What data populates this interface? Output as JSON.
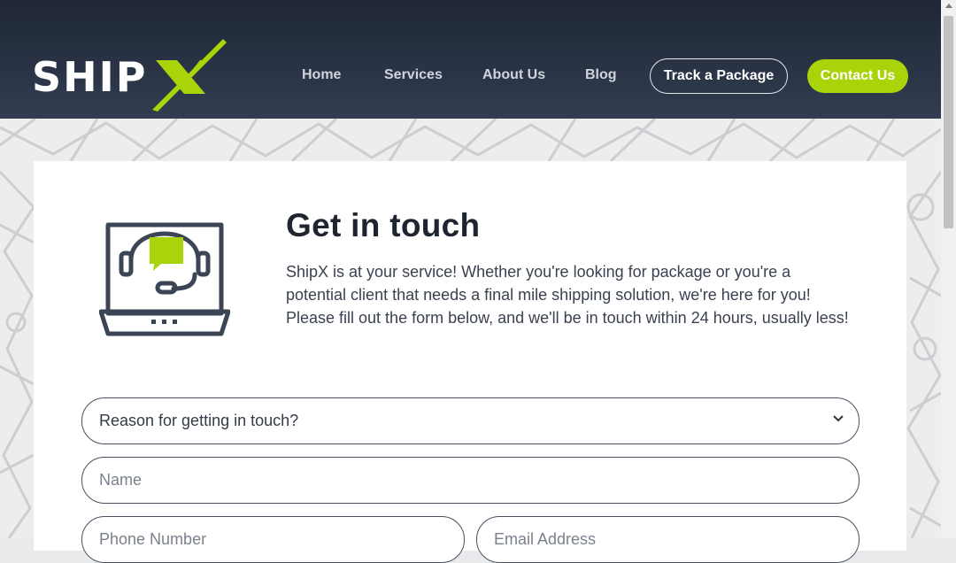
{
  "header": {
    "logo_text": "SHIP",
    "logo_mark": "X",
    "nav": [
      "Home",
      "Services",
      "About Us",
      "Blog"
    ],
    "track_label": "Track a Package",
    "contact_label": "Contact Us"
  },
  "main": {
    "title": "Get in touch",
    "intro": "ShipX is at your service! Whether you're looking for package or you're a potential client that needs a final mile shipping solution, we're here for you! Please fill out the form below, and we'll be in touch within 24 hours, usually less!",
    "icon": "support-laptop-icon"
  },
  "form": {
    "reason_value": "Reason for getting in touch?",
    "name_placeholder": "Name",
    "phone_placeholder": "Phone Number",
    "email_placeholder": "Email Address"
  },
  "colors": {
    "header_bg": "#2a3446",
    "accent": "#a9d40a",
    "text_dark": "#1e2530"
  }
}
